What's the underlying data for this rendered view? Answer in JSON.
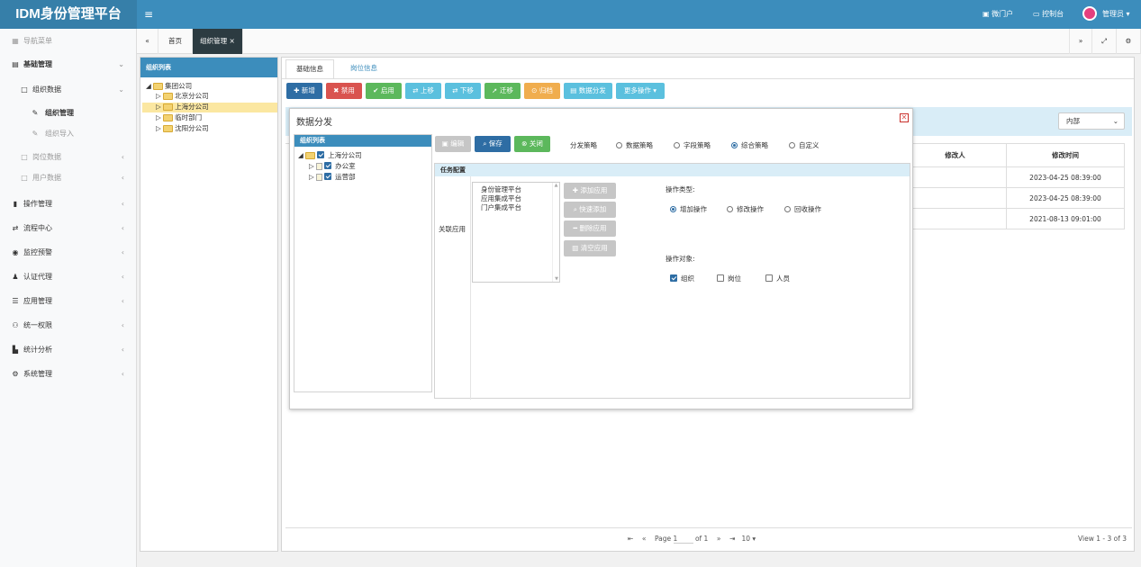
{
  "app": {
    "brand": "IDM身份管理平台"
  },
  "topbar": {
    "home_label": "微门户",
    "console_label": "控制台",
    "user_label": "管理员",
    "menu_icon": "hamburger-icon"
  },
  "sidebar": {
    "header": "导航菜单",
    "items": [
      {
        "label": "基础管理"
      },
      {
        "label": "组织数据"
      },
      {
        "label": "组织管理"
      },
      {
        "label": "组织导入"
      },
      {
        "label": "岗位数据"
      },
      {
        "label": "用户数据"
      },
      {
        "label": "操作管理"
      },
      {
        "label": "流程中心"
      },
      {
        "label": "监控预警"
      },
      {
        "label": "认证代理"
      },
      {
        "label": "应用管理"
      },
      {
        "label": "统一权限"
      },
      {
        "label": "统计分析"
      },
      {
        "label": "系统管理"
      }
    ]
  },
  "tabs": [
    {
      "label": "首页"
    },
    {
      "label": "组织管理"
    }
  ],
  "org_panel": {
    "title": "组织列表",
    "tree": [
      "集团公司",
      "北京分公司",
      "上海分公司",
      "临时部门",
      "沈阳分公司"
    ]
  },
  "content_tabs": [
    {
      "label": "基础信息"
    },
    {
      "label": "岗位信息"
    }
  ],
  "toolbar": [
    {
      "label": "新增"
    },
    {
      "label": "禁用"
    },
    {
      "label": "启用"
    },
    {
      "label": "上移"
    },
    {
      "label": "下移"
    },
    {
      "label": "迁移"
    },
    {
      "label": "归档"
    },
    {
      "label": "数据分发"
    },
    {
      "label": "更多操作"
    }
  ],
  "filter": {
    "select_value": "内部"
  },
  "table": {
    "headers": [
      "修改人",
      "修改时间"
    ],
    "rows": [
      {
        "modifier": "",
        "time": "2023-04-25 08:39:00"
      },
      {
        "modifier": "",
        "time": "2023-04-25 08:39:00"
      },
      {
        "modifier": "",
        "time": "2021-08-13 09:01:00"
      }
    ]
  },
  "pager": {
    "page_label": "Page",
    "page_value": "1",
    "of_label": "of 1",
    "page_size": "10",
    "view_text": "View 1 - 3 of 3"
  },
  "dialog": {
    "title": "数据分发",
    "left_title": "组织列表",
    "left_tree": [
      "上海分公司",
      "办公室",
      "运营部"
    ],
    "buttons": [
      {
        "label": "编辑"
      },
      {
        "label": "保存"
      },
      {
        "label": "关闭"
      }
    ],
    "strategy_label": "分发策略",
    "strategies": [
      "数据策略",
      "字段策略",
      "综合策略",
      "自定义"
    ],
    "section_title": "任务配置",
    "assoc_label": "关联应用",
    "apps": [
      "身份管理平台",
      "应用集成平台",
      "门户集成平台"
    ],
    "app_buttons": [
      {
        "label": "添加应用"
      },
      {
        "label": "快速添加"
      },
      {
        "label": "删除应用"
      },
      {
        "label": "清空应用"
      }
    ],
    "op_type_label": "操作类型:",
    "op_types": [
      "增加操作",
      "修改操作",
      "回收操作"
    ],
    "op_target_label": "操作对象:",
    "op_targets": [
      "组织",
      "岗位",
      "人员"
    ]
  }
}
